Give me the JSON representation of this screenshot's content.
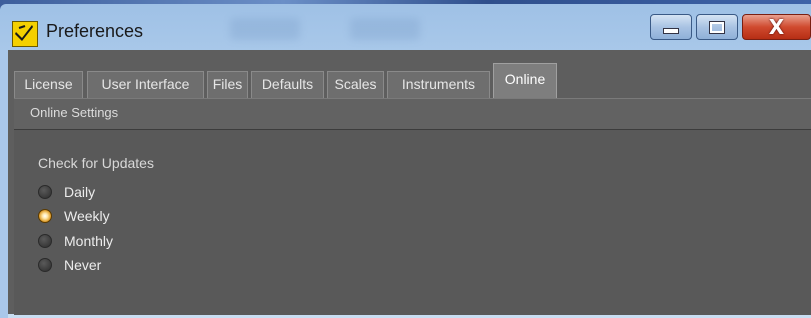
{
  "window": {
    "title": "Preferences",
    "icon": "app-logo-icon",
    "controls": {
      "minimize": "minimize-icon",
      "maximize": "maximize-icon",
      "close": "close-icon",
      "close_glyph": "X"
    }
  },
  "tabs": [
    {
      "label": "License"
    },
    {
      "label": "User Interface"
    },
    {
      "label": "Files"
    },
    {
      "label": "Defaults"
    },
    {
      "label": "Scales"
    },
    {
      "label": "Instruments"
    },
    {
      "label": "Online",
      "active": true
    }
  ],
  "section": {
    "title": "Online Settings"
  },
  "updates": {
    "label": "Check for Updates",
    "options": [
      {
        "label": "Daily",
        "checked": false
      },
      {
        "label": "Weekly",
        "checked": true
      },
      {
        "label": "Monthly",
        "checked": false
      },
      {
        "label": "Never",
        "checked": false
      }
    ]
  },
  "colors": {
    "dialog_bg": "#5e5e5e",
    "accent_checked": "#e0a030",
    "titlebar": "#b8d3ee",
    "close_button": "#d04a2f"
  }
}
